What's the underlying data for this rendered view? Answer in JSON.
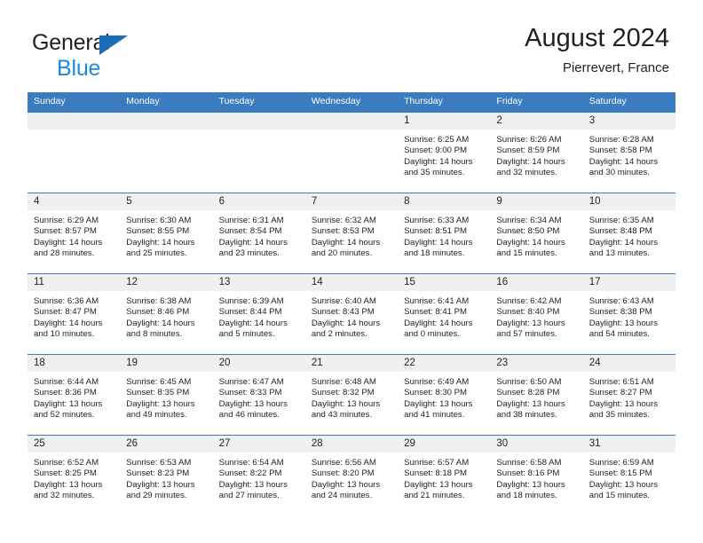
{
  "brand": {
    "line1": "General",
    "line2": "Blue",
    "triangle_color": "#1c6cb5",
    "blue_text_color": "#1b8ae0"
  },
  "header": {
    "title": "August 2024",
    "location": "Pierrevert, France"
  },
  "theme": {
    "header_row_bg": "#3a7cbf",
    "daynum_bg": "#f0f0f0",
    "divider": "#3a7cbf",
    "text": "#231f20"
  },
  "weekdays": [
    "Sunday",
    "Monday",
    "Tuesday",
    "Wednesday",
    "Thursday",
    "Friday",
    "Saturday"
  ],
  "weeks": [
    [
      {
        "day": "",
        "sunrise": "",
        "sunset": "",
        "daylight1": "",
        "daylight2": "",
        "empty": true
      },
      {
        "day": "",
        "sunrise": "",
        "sunset": "",
        "daylight1": "",
        "daylight2": "",
        "empty": true
      },
      {
        "day": "",
        "sunrise": "",
        "sunset": "",
        "daylight1": "",
        "daylight2": "",
        "empty": true
      },
      {
        "day": "",
        "sunrise": "",
        "sunset": "",
        "daylight1": "",
        "daylight2": "",
        "empty": true
      },
      {
        "day": "1",
        "sunrise": "Sunrise: 6:25 AM",
        "sunset": "Sunset: 9:00 PM",
        "daylight1": "Daylight: 14 hours",
        "daylight2": "and 35 minutes."
      },
      {
        "day": "2",
        "sunrise": "Sunrise: 6:26 AM",
        "sunset": "Sunset: 8:59 PM",
        "daylight1": "Daylight: 14 hours",
        "daylight2": "and 32 minutes."
      },
      {
        "day": "3",
        "sunrise": "Sunrise: 6:28 AM",
        "sunset": "Sunset: 8:58 PM",
        "daylight1": "Daylight: 14 hours",
        "daylight2": "and 30 minutes."
      }
    ],
    [
      {
        "day": "4",
        "sunrise": "Sunrise: 6:29 AM",
        "sunset": "Sunset: 8:57 PM",
        "daylight1": "Daylight: 14 hours",
        "daylight2": "and 28 minutes."
      },
      {
        "day": "5",
        "sunrise": "Sunrise: 6:30 AM",
        "sunset": "Sunset: 8:55 PM",
        "daylight1": "Daylight: 14 hours",
        "daylight2": "and 25 minutes."
      },
      {
        "day": "6",
        "sunrise": "Sunrise: 6:31 AM",
        "sunset": "Sunset: 8:54 PM",
        "daylight1": "Daylight: 14 hours",
        "daylight2": "and 23 minutes."
      },
      {
        "day": "7",
        "sunrise": "Sunrise: 6:32 AM",
        "sunset": "Sunset: 8:53 PM",
        "daylight1": "Daylight: 14 hours",
        "daylight2": "and 20 minutes."
      },
      {
        "day": "8",
        "sunrise": "Sunrise: 6:33 AM",
        "sunset": "Sunset: 8:51 PM",
        "daylight1": "Daylight: 14 hours",
        "daylight2": "and 18 minutes."
      },
      {
        "day": "9",
        "sunrise": "Sunrise: 6:34 AM",
        "sunset": "Sunset: 8:50 PM",
        "daylight1": "Daylight: 14 hours",
        "daylight2": "and 15 minutes."
      },
      {
        "day": "10",
        "sunrise": "Sunrise: 6:35 AM",
        "sunset": "Sunset: 8:48 PM",
        "daylight1": "Daylight: 14 hours",
        "daylight2": "and 13 minutes."
      }
    ],
    [
      {
        "day": "11",
        "sunrise": "Sunrise: 6:36 AM",
        "sunset": "Sunset: 8:47 PM",
        "daylight1": "Daylight: 14 hours",
        "daylight2": "and 10 minutes."
      },
      {
        "day": "12",
        "sunrise": "Sunrise: 6:38 AM",
        "sunset": "Sunset: 8:46 PM",
        "daylight1": "Daylight: 14 hours",
        "daylight2": "and 8 minutes."
      },
      {
        "day": "13",
        "sunrise": "Sunrise: 6:39 AM",
        "sunset": "Sunset: 8:44 PM",
        "daylight1": "Daylight: 14 hours",
        "daylight2": "and 5 minutes."
      },
      {
        "day": "14",
        "sunrise": "Sunrise: 6:40 AM",
        "sunset": "Sunset: 8:43 PM",
        "daylight1": "Daylight: 14 hours",
        "daylight2": "and 2 minutes."
      },
      {
        "day": "15",
        "sunrise": "Sunrise: 6:41 AM",
        "sunset": "Sunset: 8:41 PM",
        "daylight1": "Daylight: 14 hours",
        "daylight2": "and 0 minutes."
      },
      {
        "day": "16",
        "sunrise": "Sunrise: 6:42 AM",
        "sunset": "Sunset: 8:40 PM",
        "daylight1": "Daylight: 13 hours",
        "daylight2": "and 57 minutes."
      },
      {
        "day": "17",
        "sunrise": "Sunrise: 6:43 AM",
        "sunset": "Sunset: 8:38 PM",
        "daylight1": "Daylight: 13 hours",
        "daylight2": "and 54 minutes."
      }
    ],
    [
      {
        "day": "18",
        "sunrise": "Sunrise: 6:44 AM",
        "sunset": "Sunset: 8:36 PM",
        "daylight1": "Daylight: 13 hours",
        "daylight2": "and 52 minutes."
      },
      {
        "day": "19",
        "sunrise": "Sunrise: 6:45 AM",
        "sunset": "Sunset: 8:35 PM",
        "daylight1": "Daylight: 13 hours",
        "daylight2": "and 49 minutes."
      },
      {
        "day": "20",
        "sunrise": "Sunrise: 6:47 AM",
        "sunset": "Sunset: 8:33 PM",
        "daylight1": "Daylight: 13 hours",
        "daylight2": "and 46 minutes."
      },
      {
        "day": "21",
        "sunrise": "Sunrise: 6:48 AM",
        "sunset": "Sunset: 8:32 PM",
        "daylight1": "Daylight: 13 hours",
        "daylight2": "and 43 minutes."
      },
      {
        "day": "22",
        "sunrise": "Sunrise: 6:49 AM",
        "sunset": "Sunset: 8:30 PM",
        "daylight1": "Daylight: 13 hours",
        "daylight2": "and 41 minutes."
      },
      {
        "day": "23",
        "sunrise": "Sunrise: 6:50 AM",
        "sunset": "Sunset: 8:28 PM",
        "daylight1": "Daylight: 13 hours",
        "daylight2": "and 38 minutes."
      },
      {
        "day": "24",
        "sunrise": "Sunrise: 6:51 AM",
        "sunset": "Sunset: 8:27 PM",
        "daylight1": "Daylight: 13 hours",
        "daylight2": "and 35 minutes."
      }
    ],
    [
      {
        "day": "25",
        "sunrise": "Sunrise: 6:52 AM",
        "sunset": "Sunset: 8:25 PM",
        "daylight1": "Daylight: 13 hours",
        "daylight2": "and 32 minutes."
      },
      {
        "day": "26",
        "sunrise": "Sunrise: 6:53 AM",
        "sunset": "Sunset: 8:23 PM",
        "daylight1": "Daylight: 13 hours",
        "daylight2": "and 29 minutes."
      },
      {
        "day": "27",
        "sunrise": "Sunrise: 6:54 AM",
        "sunset": "Sunset: 8:22 PM",
        "daylight1": "Daylight: 13 hours",
        "daylight2": "and 27 minutes."
      },
      {
        "day": "28",
        "sunrise": "Sunrise: 6:56 AM",
        "sunset": "Sunset: 8:20 PM",
        "daylight1": "Daylight: 13 hours",
        "daylight2": "and 24 minutes."
      },
      {
        "day": "29",
        "sunrise": "Sunrise: 6:57 AM",
        "sunset": "Sunset: 8:18 PM",
        "daylight1": "Daylight: 13 hours",
        "daylight2": "and 21 minutes."
      },
      {
        "day": "30",
        "sunrise": "Sunrise: 6:58 AM",
        "sunset": "Sunset: 8:16 PM",
        "daylight1": "Daylight: 13 hours",
        "daylight2": "and 18 minutes."
      },
      {
        "day": "31",
        "sunrise": "Sunrise: 6:59 AM",
        "sunset": "Sunset: 8:15 PM",
        "daylight1": "Daylight: 13 hours",
        "daylight2": "and 15 minutes."
      }
    ]
  ]
}
